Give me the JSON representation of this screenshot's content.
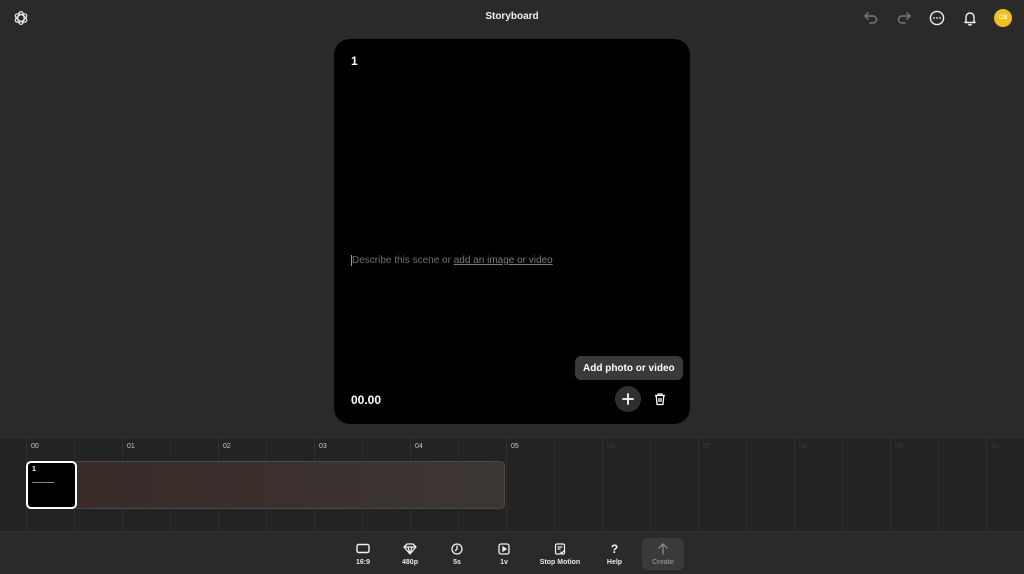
{
  "header": {
    "title": "Storyboard",
    "avatar_initials": "CB",
    "avatar_color": "#f2c01c"
  },
  "icons": {
    "logo": "openai-logo-icon",
    "undo": "undo-icon",
    "redo": "redo-icon",
    "more": "more-horizontal-icon",
    "notifications": "bell-icon",
    "add": "plus-icon",
    "delete": "trash-icon"
  },
  "scene": {
    "number": "1",
    "prompt_prefix": "Describe this scene or ",
    "prompt_link": "add an image or video",
    "time": "00.00",
    "tooltip": "Add photo or video"
  },
  "timeline": {
    "tick_labels": [
      "00",
      "01",
      "02",
      "03",
      "04",
      "05",
      "06",
      "07",
      "08",
      "09",
      "10"
    ],
    "active_until_second": 5,
    "clip": {
      "number": "1"
    }
  },
  "toolbar": {
    "items": [
      {
        "label": "16:9",
        "icon": "aspect-ratio-icon"
      },
      {
        "label": "480p",
        "icon": "diamond-icon"
      },
      {
        "label": "5s",
        "icon": "timer-icon"
      },
      {
        "label": "1v",
        "icon": "play-square-icon"
      },
      {
        "label": "Stop Motion",
        "icon": "storyboard-icon"
      },
      {
        "label": "Help",
        "icon": "question-icon"
      },
      {
        "label": "Create",
        "icon": "arrow-up-icon",
        "disabled": true
      }
    ]
  }
}
